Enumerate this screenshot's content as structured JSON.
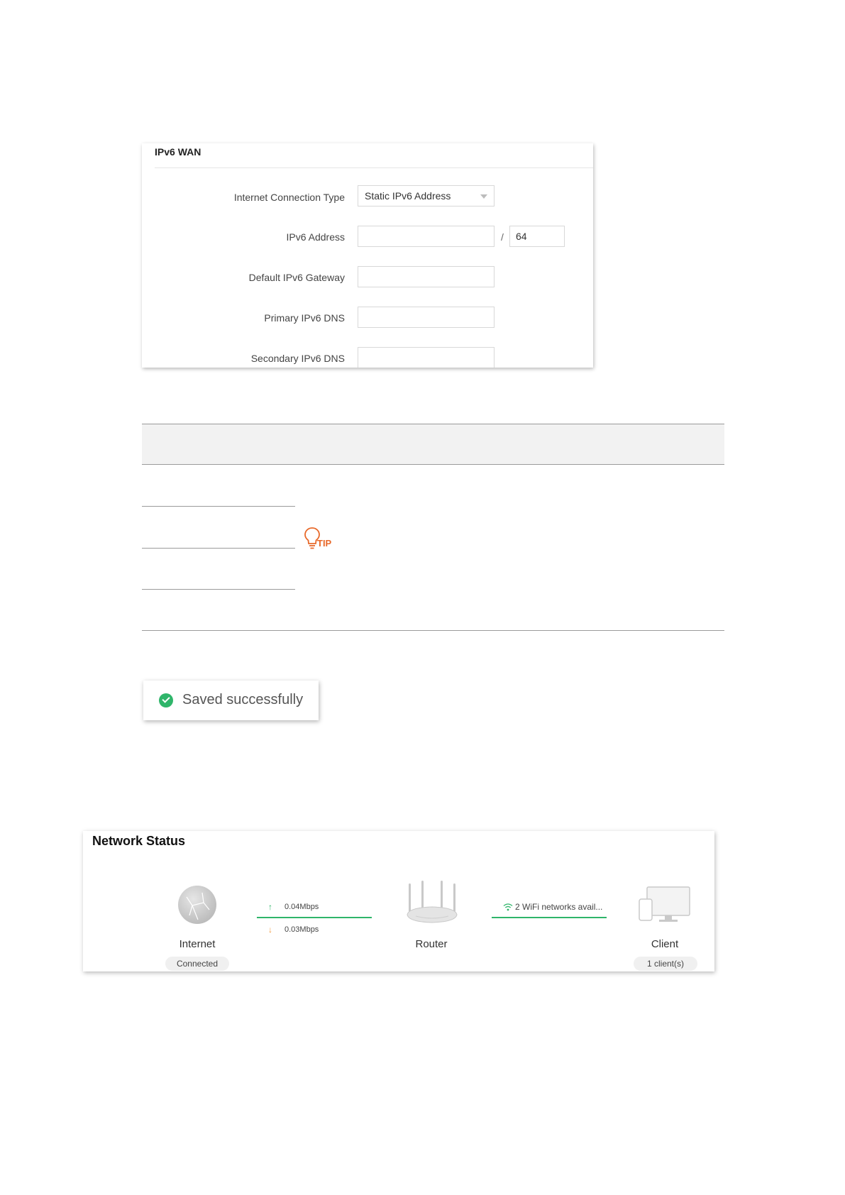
{
  "ipv6_wan": {
    "title": "IPv6 WAN",
    "fields": {
      "connection_type_label": "Internet Connection Type",
      "connection_type_value": "Static IPv6 Address",
      "address_label": "IPv6 Address",
      "address_value": "",
      "prefix_separator": "/",
      "prefix_value": "64",
      "gateway_label": "Default IPv6 Gateway",
      "gateway_value": "",
      "primary_dns_label": "Primary IPv6 DNS",
      "primary_dns_value": "",
      "secondary_dns_label": "Secondary IPv6 DNS",
      "secondary_dns_value": ""
    }
  },
  "tip": {
    "label": "TIP",
    "color": "#e8692a"
  },
  "toast": {
    "message": "Saved successfully",
    "status": "success",
    "color": "#2fb56a"
  },
  "network_status": {
    "title": "Network Status",
    "internet": {
      "label": "Internet",
      "status": "Connected",
      "icon": "globe-icon"
    },
    "upload_rate": "0.04Mbps",
    "download_rate": "0.03Mbps",
    "router": {
      "label": "Router",
      "icon": "router-icon"
    },
    "wifi_summary": "2 WiFi networks avail...",
    "client": {
      "label": "Client",
      "count": "1 client(s)",
      "icon": "devices-icon"
    },
    "accent_color": "#2fb56a"
  }
}
